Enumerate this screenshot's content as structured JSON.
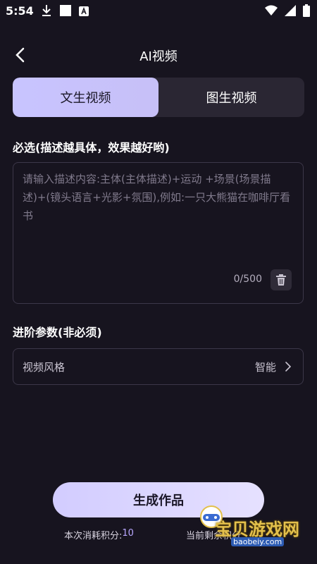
{
  "status_bar": {
    "time": "5:54",
    "icons": [
      "download-icon",
      "square-icon",
      "app-a-icon",
      "wifi-icon",
      "signal-icon",
      "battery-icon"
    ]
  },
  "header": {
    "title": "AI视频"
  },
  "tabs": [
    {
      "label": "文生视频",
      "active": true
    },
    {
      "label": "图生视频",
      "active": false
    }
  ],
  "prompt_section": {
    "label": "必选(描述越具体，效果越好哟)",
    "placeholder": "请输入描述内容:主体(主体描述)+运动 +场景(场景描述)+(镜头语言+光影+氛围),例如:一只大熊猫在咖啡厅看书",
    "count": "0/500"
  },
  "advanced_section": {
    "label": "进阶参数(非必须)",
    "style_label": "视频风格",
    "style_value": "智能"
  },
  "footer": {
    "generate_label": "生成作品",
    "cost_label": "本次消耗积分:",
    "cost_value": "10",
    "remaining_label": "当前剩余积分"
  },
  "watermark": {
    "main": "宝贝游戏网",
    "sub": "baobeiy.com"
  },
  "colors": {
    "background": "#17141f",
    "accent": "#c8c4ff",
    "panel": "#2a2633"
  }
}
